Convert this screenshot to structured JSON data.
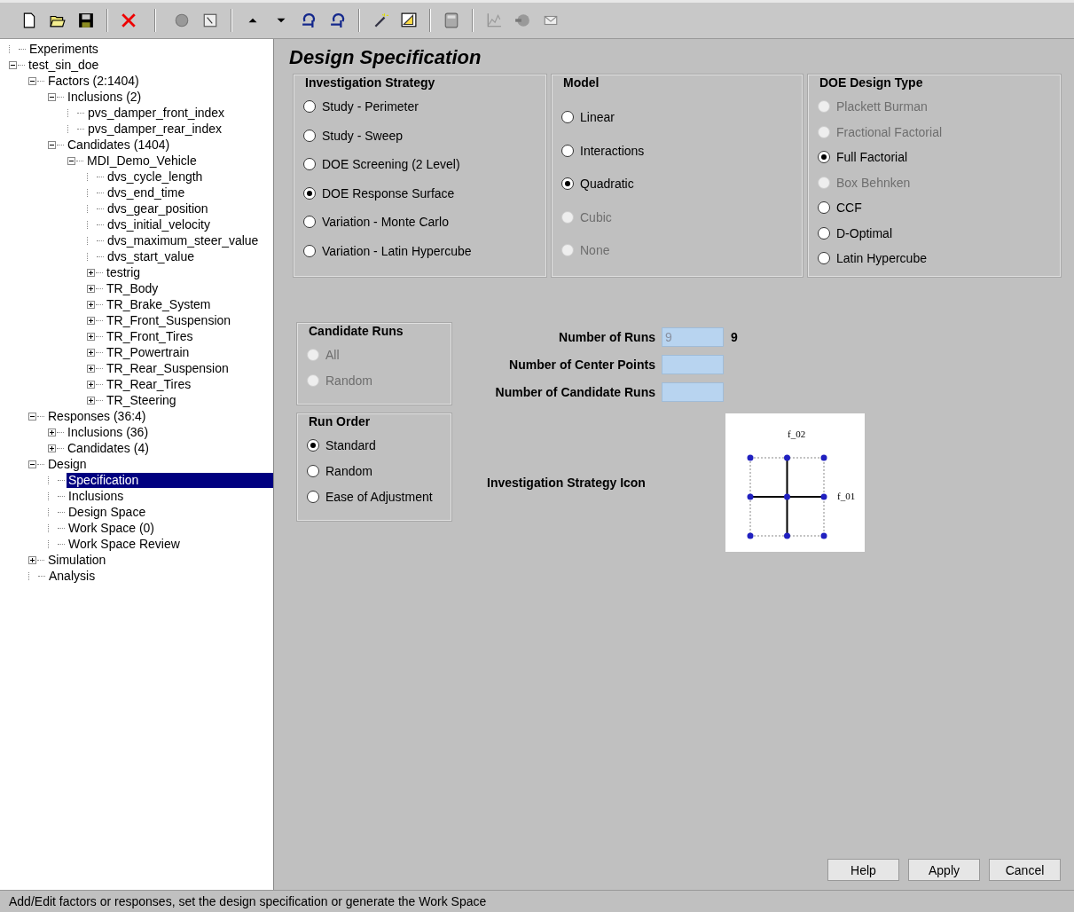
{
  "tree": [
    {
      "label": "Experiments",
      "selected": false
    },
    {
      "label": "test_sin_doe",
      "selected": false,
      "expanded": true,
      "children": [
        {
          "label": "Factors (2:1404)",
          "selected": false,
          "expanded": true,
          "children": [
            {
              "label": "Inclusions (2)",
              "selected": false,
              "expanded": true,
              "children": [
                {
                  "label": "pvs_damper_front_index",
                  "selected": false
                },
                {
                  "label": "pvs_damper_rear_index",
                  "selected": false
                }
              ]
            },
            {
              "label": "Candidates (1404)",
              "selected": false,
              "expanded": true,
              "children": [
                {
                  "label": "MDI_Demo_Vehicle",
                  "selected": false,
                  "expanded": true,
                  "children": [
                    {
                      "label": "dvs_cycle_length",
                      "selected": false
                    },
                    {
                      "label": "dvs_end_time",
                      "selected": false
                    },
                    {
                      "label": "dvs_gear_position",
                      "selected": false
                    },
                    {
                      "label": "dvs_initial_velocity",
                      "selected": false
                    },
                    {
                      "label": "dvs_maximum_steer_value",
                      "selected": false
                    },
                    {
                      "label": "dvs_start_value",
                      "selected": false
                    },
                    {
                      "label": "testrig",
                      "selected": false,
                      "expanded": false
                    },
                    {
                      "label": "TR_Body",
                      "selected": false,
                      "expanded": false
                    },
                    {
                      "label": "TR_Brake_System",
                      "selected": false,
                      "expanded": false
                    },
                    {
                      "label": "TR_Front_Suspension",
                      "selected": false,
                      "expanded": false
                    },
                    {
                      "label": "TR_Front_Tires",
                      "selected": false,
                      "expanded": false
                    },
                    {
                      "label": "TR_Powertrain",
                      "selected": false,
                      "expanded": false
                    },
                    {
                      "label": "TR_Rear_Suspension",
                      "selected": false,
                      "expanded": false
                    },
                    {
                      "label": "TR_Rear_Tires",
                      "selected": false,
                      "expanded": false
                    },
                    {
                      "label": "TR_Steering",
                      "selected": false,
                      "expanded": false
                    }
                  ]
                }
              ]
            }
          ]
        },
        {
          "label": "Responses (36:4)",
          "selected": false,
          "expanded": true,
          "children": [
            {
              "label": "Inclusions (36)",
              "selected": false,
              "expanded": false
            },
            {
              "label": "Candidates (4)",
              "selected": false,
              "expanded": false
            }
          ]
        },
        {
          "label": "Design",
          "selected": false,
          "expanded": true,
          "children": [
            {
              "label": "Specification",
              "selected": true
            },
            {
              "label": "Inclusions",
              "selected": false
            },
            {
              "label": "Design Space",
              "selected": false
            },
            {
              "label": "Work Space (0)",
              "selected": false
            },
            {
              "label": "Work Space Review",
              "selected": false
            }
          ]
        },
        {
          "label": "Simulation",
          "selected": false,
          "expanded": false
        },
        {
          "label": "Analysis",
          "selected": false
        }
      ]
    }
  ],
  "title": "Design Specification",
  "top_groups": [
    {
      "title": "Investigation Strategy",
      "options": [
        {
          "label": "Study - Perimeter",
          "selected": false,
          "disabled": false
        },
        {
          "label": "Study - Sweep",
          "selected": false,
          "disabled": false
        },
        {
          "label": "DOE Screening (2 Level)",
          "selected": false,
          "disabled": false
        },
        {
          "label": "DOE Response Surface",
          "selected": true,
          "disabled": false
        },
        {
          "label": "Variation - Monte Carlo",
          "selected": false,
          "disabled": false
        },
        {
          "label": "Variation - Latin Hypercube",
          "selected": false,
          "disabled": false
        }
      ]
    },
    {
      "title": "Model",
      "options": [
        {
          "label": "Linear",
          "selected": false,
          "disabled": false
        },
        {
          "label": "Interactions",
          "selected": false,
          "disabled": false
        },
        {
          "label": "Quadratic",
          "selected": true,
          "disabled": false
        },
        {
          "label": "Cubic",
          "selected": false,
          "disabled": true
        },
        {
          "label": "None",
          "selected": false,
          "disabled": true
        }
      ]
    },
    {
      "title": "DOE Design Type",
      "options": [
        {
          "label": "Plackett Burman",
          "selected": false,
          "disabled": true
        },
        {
          "label": "Fractional Factorial",
          "selected": false,
          "disabled": true
        },
        {
          "label": "Full Factorial",
          "selected": true,
          "disabled": false
        },
        {
          "label": "Box Behnken",
          "selected": false,
          "disabled": true
        },
        {
          "label": "CCF",
          "selected": false,
          "disabled": false
        },
        {
          "label": "D-Optimal",
          "selected": false,
          "disabled": false
        },
        {
          "label": "Latin Hypercube",
          "selected": false,
          "disabled": false
        }
      ]
    }
  ],
  "left_groups": [
    {
      "title": "Candidate Runs",
      "options": [
        {
          "label": "All",
          "selected": false,
          "disabled": true
        },
        {
          "label": "Random",
          "selected": false,
          "disabled": true
        }
      ]
    },
    {
      "title": "Run Order",
      "options": [
        {
          "label": "Standard",
          "selected": true,
          "disabled": false
        },
        {
          "label": "Random",
          "selected": false,
          "disabled": false
        },
        {
          "label": "Ease of Adjustment",
          "selected": false,
          "disabled": false
        }
      ]
    }
  ],
  "fields": [
    {
      "label": "Number of Runs",
      "value": "9",
      "note": "9"
    },
    {
      "label": "Number of Center Points"
    },
    {
      "label": "Number of Candidate Runs"
    }
  ],
  "strategy_icon": {
    "label": "Investigation Strategy Icon",
    "x_factor": "f_01",
    "y_factor": "f_02"
  },
  "buttons": [
    "Help",
    "Apply",
    "Cancel"
  ],
  "status_bar": "Add/Edit factors or responses, set the design specification or generate the Work Space"
}
